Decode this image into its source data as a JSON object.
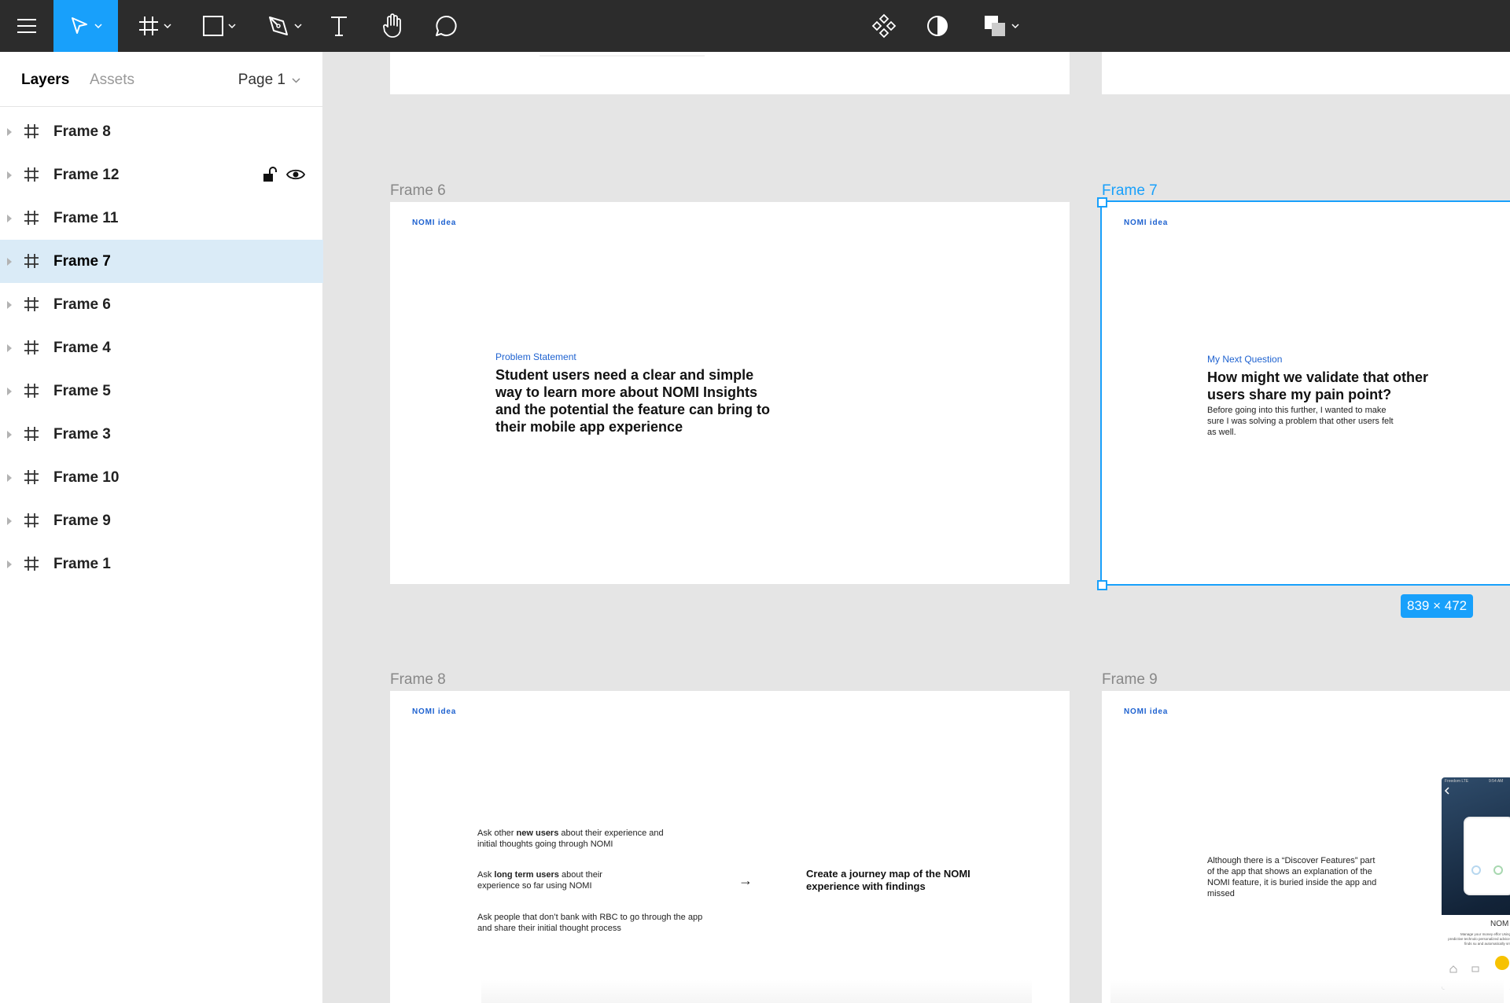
{
  "sidebar": {
    "tabs": [
      "Layers",
      "Assets"
    ],
    "page_selector": "Page 1",
    "layers": [
      {
        "name": "Frame 8"
      },
      {
        "name": "Frame 12"
      },
      {
        "name": "Frame 11"
      },
      {
        "name": "Frame 7"
      },
      {
        "name": "Frame 6"
      },
      {
        "name": "Frame 4"
      },
      {
        "name": "Frame 5"
      },
      {
        "name": "Frame 3"
      },
      {
        "name": "Frame 10"
      },
      {
        "name": "Frame 9"
      },
      {
        "name": "Frame 1"
      }
    ],
    "selected_layer": "Frame 7"
  },
  "canvas": {
    "frame6": {
      "label": "Frame 6",
      "brand": "NOMI idea",
      "eyebrow": "Problem Statement",
      "headline": "Student users need a clear and simple way to learn more about NOMI Insights and the potential the feature can bring to their mobile app experience"
    },
    "frame7": {
      "label": "Frame 7",
      "brand": "NOMI idea",
      "eyebrow": "My Next Question",
      "headline": "How might we validate that other users share my pain point?",
      "body": "Before going into this further, I wanted to make sure I was solving a problem that other users felt as well.",
      "dimensions": "839 × 472"
    },
    "frame8": {
      "label": "Frame 8",
      "brand": "NOMI idea",
      "item1_pre": "Ask other ",
      "item1_bold": "new users",
      "item1_post": " about their experience and initial thoughts going through NOMI",
      "item2_pre": "Ask ",
      "item2_bold": "long term users",
      "item2_post": " about their experience so far using NOMI",
      "item3": "Ask people that don’t bank with RBC to go through the app and share their initial thought process",
      "arrow": "→",
      "outcome": "Create a journey map of the NOMI experience with findings"
    },
    "frame9": {
      "label": "Frame 9",
      "brand": "NOMI idea",
      "body": "Although there is a “Discover Features” part of the app that shows an explanation of the NOMI feature, it is buried inside the app and missed",
      "phone_status": "Freedom LTE",
      "phone_time": "9:54 AM",
      "phone_title": "NOM",
      "phone_caption": "Manage your money effor Using predictive technolo personalized advice, finds su and automatically sm"
    }
  },
  "colors": {
    "accent": "#18a0fb",
    "toolbar": "#2c2c2c",
    "brand_blue": "#1e62d0"
  },
  "toolbar": {
    "icons": [
      "menu-icon",
      "move-icon",
      "frame-icon",
      "rectangle-icon",
      "pen-icon",
      "text-icon",
      "hand-icon",
      "comment-icon",
      "component-icon",
      "mask-icon",
      "boolean-icon"
    ]
  }
}
